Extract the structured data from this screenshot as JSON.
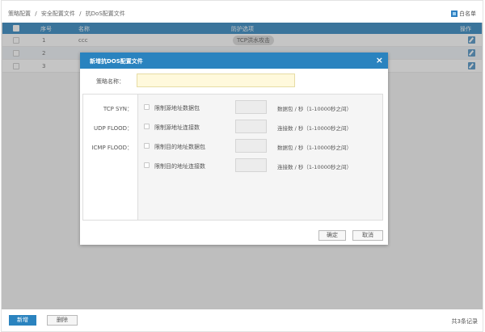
{
  "breadcrumb": [
    "策略配置",
    "/",
    "安全配置文件",
    "/",
    "抗DoS配置文件"
  ],
  "whitelist_label": "白名单",
  "table": {
    "headers": {
      "index": "序号",
      "name": "名称",
      "protection": "防护选项",
      "action": "操作"
    },
    "rows": [
      {
        "index": "1",
        "name": "ccc",
        "protection": "TCP洪水攻击"
      },
      {
        "index": "2",
        "name": "",
        "protection": ""
      },
      {
        "index": "3",
        "name": "",
        "protection": ""
      }
    ]
  },
  "modal": {
    "title": "新增抗DOS配置文件",
    "close": "×",
    "name_label": "策略名称：",
    "name_value": "",
    "tabs": [
      "TCP SYN：",
      "UDP FLOOD：",
      "ICMP FLOOD："
    ],
    "options": [
      {
        "label": "限制源地址数据包",
        "unit": "数据包 / 秒（1-10000秒之间）"
      },
      {
        "label": "限制源地址连接数",
        "unit": "连接数 / 秒（1-10000秒之间）"
      },
      {
        "label": "限制目的地址数据包",
        "unit": "数据包 / 秒（1-10000秒之间）"
      },
      {
        "label": "限制目的地址连接数",
        "unit": "连接数 / 秒（1-10000秒之间）"
      }
    ],
    "ok": "确定",
    "cancel": "取消"
  },
  "bottom": {
    "add": "新增",
    "delete": "删除",
    "total": "共3条记录"
  },
  "colors": {
    "primary": "#2a83bf",
    "input_highlight": "#fff9dc"
  }
}
